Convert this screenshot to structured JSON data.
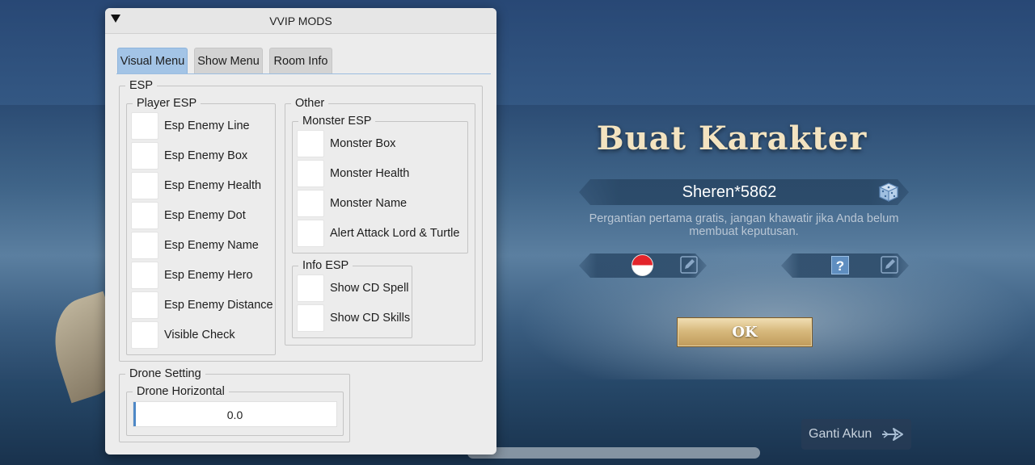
{
  "menu": {
    "title": "VVIP MODS",
    "tabs": [
      {
        "label": "Visual Menu",
        "active": true
      },
      {
        "label": "Show Menu",
        "active": false
      },
      {
        "label": "Room Info",
        "active": false
      }
    ],
    "esp": {
      "legend": "ESP",
      "player_esp": {
        "legend": "Player ESP",
        "items": [
          "Esp Enemy Line",
          "Esp Enemy Box",
          "Esp Enemy Health",
          "Esp Enemy Dot",
          "Esp Enemy Name",
          "Esp Enemy Hero",
          "Esp Enemy Distance",
          "Visible Check"
        ]
      },
      "other": {
        "legend": "Other",
        "monster_esp": {
          "legend": "Monster ESP",
          "items": [
            "Monster Box",
            "Monster Health",
            "Monster Name",
            "Alert Attack Lord & Turtle"
          ]
        },
        "info_esp": {
          "legend": "Info ESP",
          "items": [
            "Show CD Spell",
            "Show CD Skills"
          ]
        }
      }
    },
    "drone": {
      "legend": "Drone Setting",
      "horizontal": {
        "legend": "Drone Horizontal",
        "value": "0.0"
      }
    }
  },
  "game": {
    "title": "Buat Karakter",
    "player_name": "Sheren*5862",
    "hint": "Pergantian pertama gratis, jangan khawatir jika Anda belum membuat keputusan.",
    "region_placeholder": "?",
    "ok_label": "OK",
    "switch_account_label": "Ganti Akun"
  },
  "icons": {
    "collapse": "triangle-down-icon",
    "dice": "dice-icon",
    "edit": "edit-icon",
    "flag": "indonesia-flag-icon",
    "question": "question-icon",
    "arrow": "arrow-right-icon"
  },
  "colors": {
    "active_tab": "#a3c4e6",
    "menu_bg": "#ececec",
    "title_gold": "#f3e3c0",
    "ok_gold": "#d7b97d"
  }
}
